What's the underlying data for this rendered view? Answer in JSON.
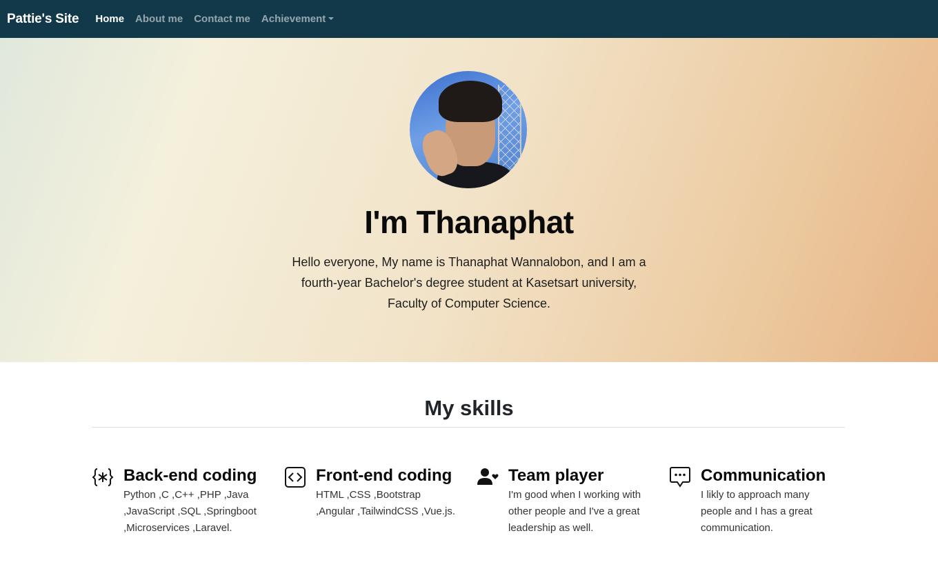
{
  "nav": {
    "brand": "Pattie's Site",
    "items": [
      {
        "label": "Home",
        "active": true
      },
      {
        "label": "About me",
        "active": false
      },
      {
        "label": "Contact me",
        "active": false
      },
      {
        "label": "Achievement",
        "active": false,
        "dropdown": true
      }
    ]
  },
  "hero": {
    "title": "I'm Thanaphat",
    "text": "Hello everyone, My name is Thanaphat Wannalobon, and I am a fourth-year Bachelor's degree student at Kasetsart university, Faculty of Computer Science."
  },
  "skills": {
    "title": "My skills",
    "items": [
      {
        "icon": "braces-asterisk-icon",
        "heading": "Back-end coding",
        "desc": "Python ,C ,C++ ,PHP ,Java ,JavaScript ,SQL ,Springboot ,Microservices ,Laravel."
      },
      {
        "icon": "code-square-icon",
        "heading": "Front-end coding",
        "desc": "HTML ,CSS ,Bootstrap ,Angular ,TailwindCSS ,Vue.js."
      },
      {
        "icon": "person-heart-icon",
        "heading": "Team player",
        "desc": "I'm good when I working with other people and I've a great leadership as well."
      },
      {
        "icon": "chat-dots-icon",
        "heading": "Communication",
        "desc": "I likly to approach many people and I has a great communication."
      }
    ]
  },
  "colors": {
    "navbar": "#12394a",
    "hero_gradient_start": "#e0e8dc",
    "hero_gradient_end": "#e7b486"
  }
}
